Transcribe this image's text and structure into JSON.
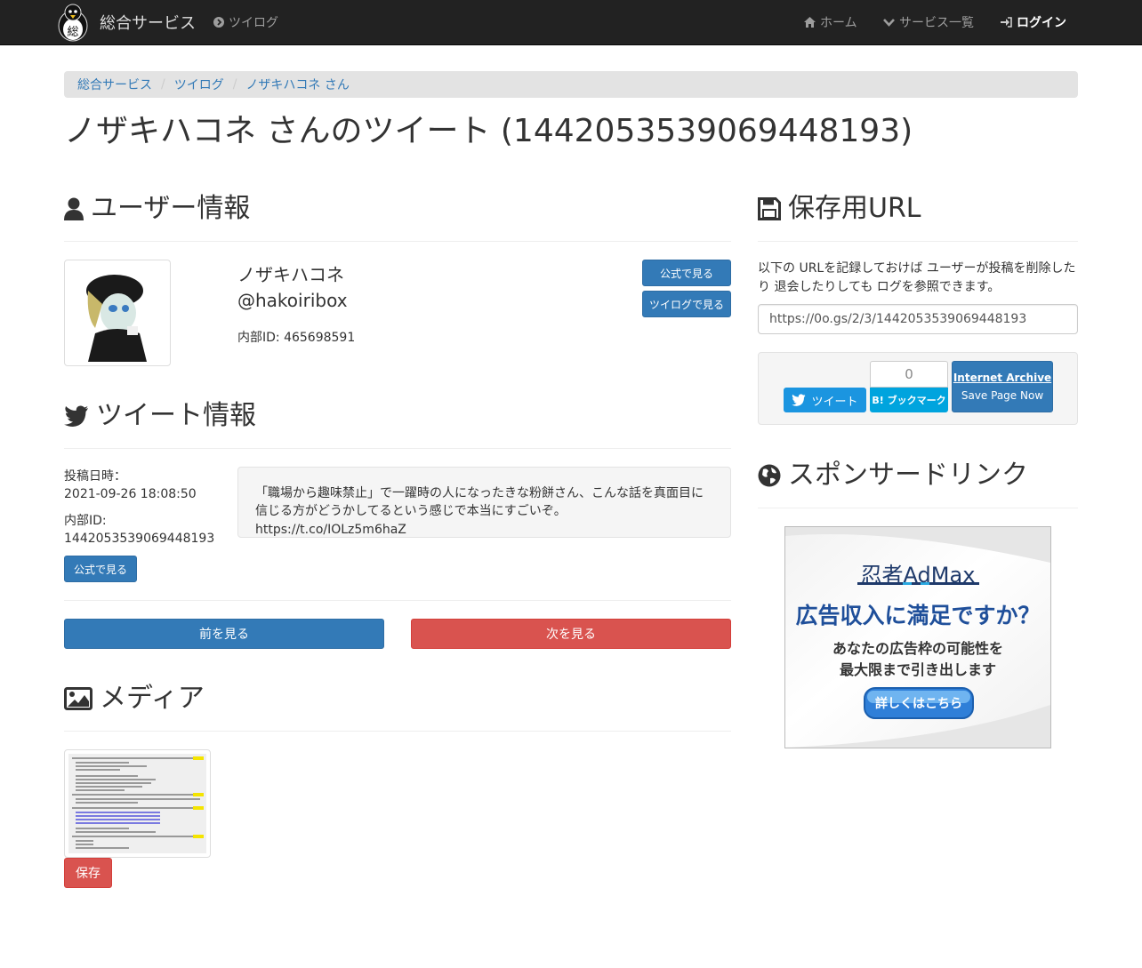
{
  "navbar": {
    "brand": "総合サービス",
    "twilog": "ツイログ",
    "home": "ホーム",
    "services": "サービス一覧",
    "login": "ログイン"
  },
  "breadcrumb": [
    "総合サービス",
    "ツイログ",
    "ノザキハコネ さん"
  ],
  "page_title": "ノザキハコネ さんのツイート (1442053539069448193)",
  "user": {
    "heading": "ユーザー情報",
    "name": "ノザキハコネ",
    "handle": "@hakoiribox",
    "internal_id": "内部ID: 465698591",
    "btn_official": "公式で見る",
    "btn_twilog": "ツイログで見る"
  },
  "tweet": {
    "heading": "ツイート情報",
    "posted_label": "投稿日時：",
    "posted_value": "2021-09-26 18:08:50",
    "id_label": "内部ID:",
    "id_value": "1442053539069448193",
    "btn_official": "公式で見る",
    "text": "「職場から趣味禁止」で一躍時の人になったきな粉餅さん、こんな話を真面目に信じる方がどうかしてるという感じで本当にすごいぞ。 https://t.co/IOLz5m6haZ"
  },
  "pager": {
    "prev": "前を見る",
    "next": "次を見る"
  },
  "media": {
    "heading": "メディア",
    "save": "保存"
  },
  "save_url": {
    "heading": "保存用URL",
    "description": "以下の URLを記録しておけば ユーザーが投稿を削除したり 退会したりしても ログを参照できます。",
    "url": "https://0o.gs/2/3/1442053539069448193",
    "tweet_btn": "ツイート",
    "bookmark_count": "0",
    "bookmark_btn": "B! ブックマーク",
    "archive_title": "Internet Archive",
    "archive_sub": "Save Page Now"
  },
  "sponsor": {
    "heading": "スポンサードリンク",
    "ad_brand": "忍者AdMax",
    "ad_headline": "広告収入に満足ですか？",
    "ad_line1": "あなたの広告枠の可能性を",
    "ad_line2": "最大限まで引き出します",
    "ad_button": "詳しくはこちら"
  },
  "colors": {
    "navbar": "#222222",
    "primary": "#337ab7",
    "danger": "#d9534f",
    "twitter": "#1b95e0",
    "hatena": "#00a4de"
  }
}
